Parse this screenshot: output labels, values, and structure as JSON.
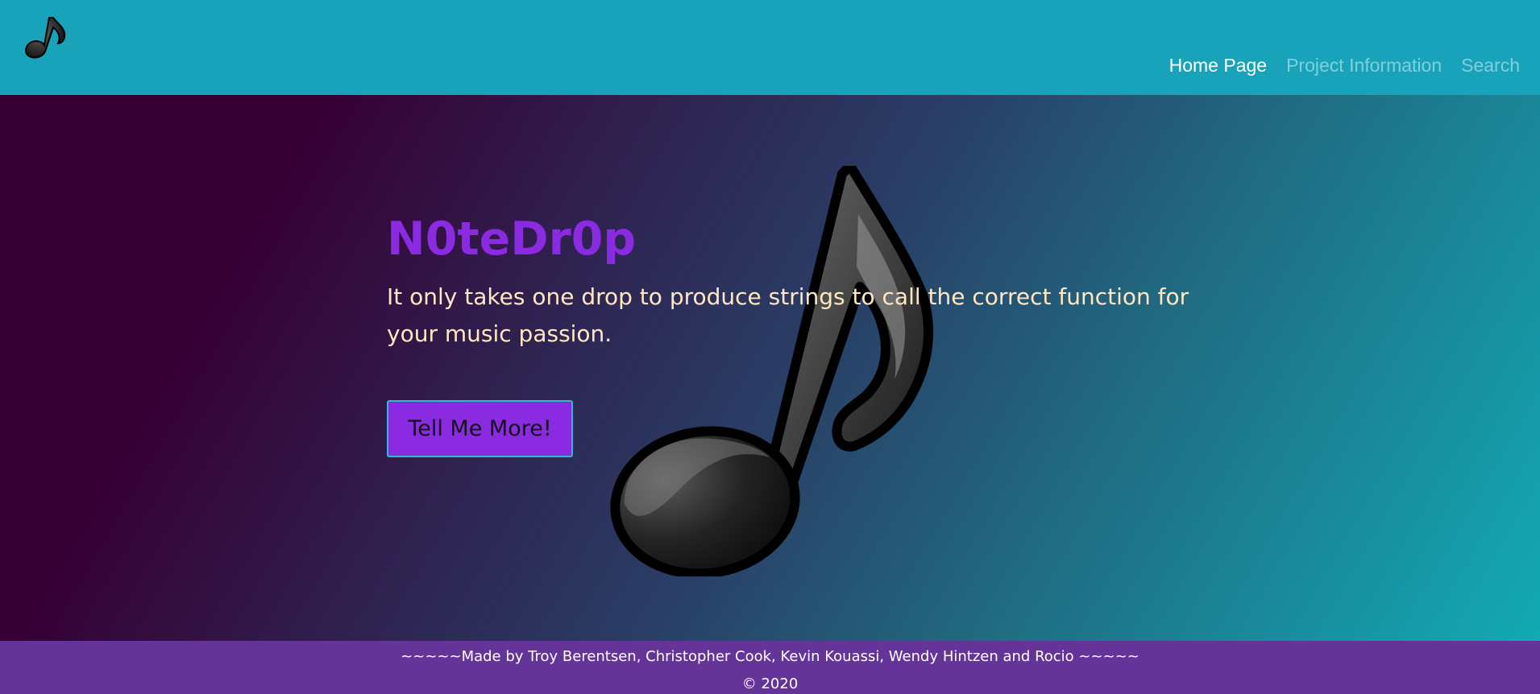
{
  "navbar": {
    "logo_icon": "music-note-icon",
    "links": [
      {
        "label": "Home Page",
        "active": true
      },
      {
        "label": "Project Information",
        "active": false
      },
      {
        "label": "Search",
        "active": false
      }
    ]
  },
  "hero": {
    "title": "N0teDr0p",
    "tagline": "It only takes one drop to produce strings to call the correct function for your music passion.",
    "button_label": "Tell Me More!",
    "background_icon": "music-note-icon",
    "colors": {
      "title": "#8a2be2",
      "tagline": "#ffe7c2",
      "button": "#8a2be2"
    }
  },
  "footer": {
    "credits": "~~~~~Made by Troy Berentsen, Christopher Cook, Kevin Kouassi, Wendy Hintzen and Rocio ~~~~~",
    "copyright": "© 2020"
  },
  "colors": {
    "navbar": "#19a3bb",
    "footer": "#653498"
  }
}
